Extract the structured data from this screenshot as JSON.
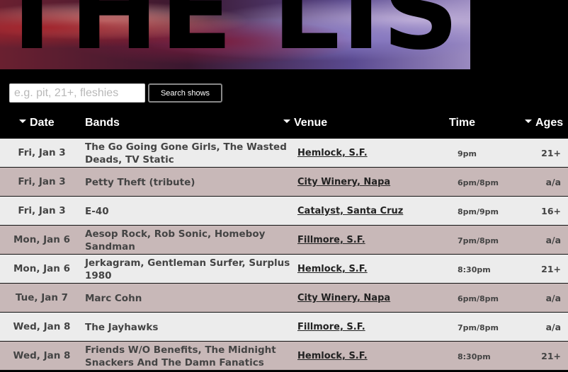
{
  "banner": {
    "title": "THE LIST"
  },
  "search": {
    "placeholder": "e.g. pit, 21+, fleshies",
    "value": "",
    "button_label": "Search shows"
  },
  "table": {
    "headers": {
      "date": "Date",
      "bands": "Bands",
      "venue": "Venue",
      "time": "Time",
      "ages": "Ages"
    },
    "rows": [
      {
        "date": "Fri, Jan 3",
        "bands": "The Go Going Gone Girls, The Wasted Deads, TV Static",
        "venue": "Hemlock, S.F.",
        "time": "9pm",
        "ages": "21+"
      },
      {
        "date": "Fri, Jan 3",
        "bands": "Petty Theft (tribute)",
        "venue": "City Winery, Napa",
        "time": "6pm/8pm",
        "ages": "a/a"
      },
      {
        "date": "Fri, Jan 3",
        "bands": "E-40",
        "venue": "Catalyst, Santa Cruz",
        "time": "8pm/9pm",
        "ages": "16+"
      },
      {
        "date": "Mon, Jan 6",
        "bands": "Aesop Rock, Rob Sonic, Homeboy Sandman",
        "venue": "Fillmore, S.F.",
        "time": "7pm/8pm",
        "ages": "a/a"
      },
      {
        "date": "Mon, Jan 6",
        "bands": "Jerkagram, Gentleman Surfer, Surplus 1980",
        "venue": "Hemlock, S.F.",
        "time": "8:30pm",
        "ages": "21+"
      },
      {
        "date": "Tue, Jan 7",
        "bands": "Marc Cohn",
        "venue": "City Winery, Napa",
        "time": "6pm/8pm",
        "ages": "a/a"
      },
      {
        "date": "Wed, Jan 8",
        "bands": "The Jayhawks",
        "venue": "Fillmore, S.F.",
        "time": "7pm/8pm",
        "ages": "a/a"
      },
      {
        "date": "Wed, Jan 8",
        "bands": "Friends W/O Benefits, The Midnight Snackers And The Damn Fanatics",
        "venue": "Hemlock, S.F.",
        "time": "8:30pm",
        "ages": "21+"
      }
    ]
  },
  "colors": {
    "background": "#000000",
    "row_light": "#ececec",
    "row_dark": "#c8b8b8",
    "header_text": "#ffffff"
  }
}
